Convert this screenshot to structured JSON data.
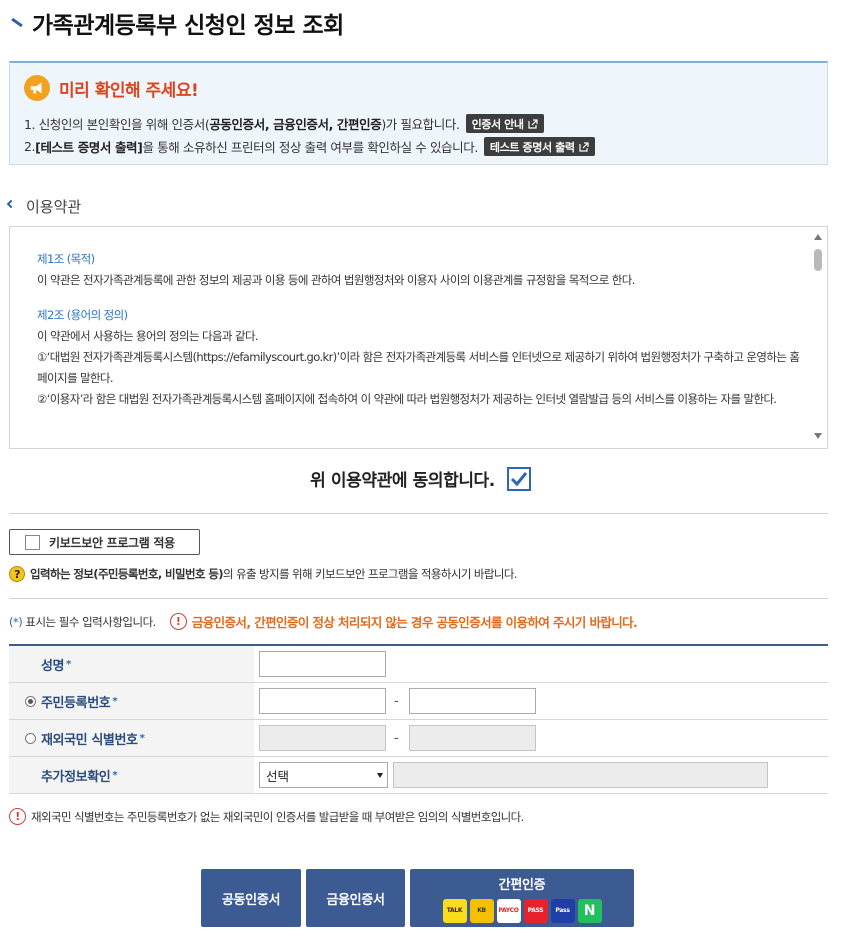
{
  "page": {
    "title": "가족관계등록부 신청인 정보 조회"
  },
  "notice": {
    "heading": "미리 확인해 주세요!",
    "line1_prefix": "1. 신청인의 본인확인을 위해 인증서(",
    "line1_bold": "공동인증서, 금융인증서, 간편인증",
    "line1_suffix": ")가 필요합니다.",
    "cert_guide_btn": "인증서 안내",
    "line2_prefix": "2. ",
    "line2_bold": "[테스트 증명서 출력]",
    "line2_suffix": "을 통해 소유하신 프린터의 정상 출력 여부를 확인하실 수 있습니다.",
    "test_print_btn": "테스트 증명서 출력"
  },
  "terms": {
    "label": "이용약관",
    "art1_title": "제1조 (목적)",
    "art1_text": "이 약관은 전자가족관계등록에 관한 정보의 제공과 이용 등에 관하여 법원행정처와 이용자 사이의 이용관계를 규정함을 목적으로 한다.",
    "art2_title": "제2조 (용어의 정의)",
    "art2_intro": "이 약관에서 사용하는 용어의 정의는 다음과 같다.",
    "art2_item1": "①‘대법원 전자가족관계등록시스템(https://efamilyscourt.go.kr)’이라 함은 전자가족관계등록 서비스를 인터넷으로 제공하기 위하여 법원행정처가 구축하고 운영하는 홈페이지를 말한다.",
    "art2_item2": "②‘이용자’라 함은 대법원 전자가족관계등록시스템 홈페이지에 접속하여 이 약관에 따라 법원행정처가 제공하는 인터넷 열람발급 등의 서비스를 이용하는 자를 말한다."
  },
  "agree": {
    "text": "위 이용약관에 동의합니다.",
    "checked": true
  },
  "keyboard": {
    "btn_label": "키보드보안 프로그램 적용",
    "note_bold": "입력하는 정보(주민등록번호, 비밀번호 등)",
    "note_rest": "의 유출 방지를 위해 키보드보안 프로그램을 적용하시기 바랍니다."
  },
  "required": {
    "note_star": "(*)",
    "note_text": " 표시는 필수 입력사항입니다.",
    "warning": "금융인증서, 간편인증이 정상 처리되지 않는 경우 공동인증서를 이용하여 주시기 바랍니다."
  },
  "form": {
    "name_label": "성명",
    "rrn_label": "주민등록번호",
    "foreign_label": "재외국민 식별번호",
    "extra_label": "추가정보확인",
    "star": "*",
    "dash": "-",
    "extra_select": "선택"
  },
  "footnote": "재외국민 식별번호는 주민등록번호가 없는 재외국민이 인증서를 발급받을 때 부여받은 임의의 식별번호입니다.",
  "buttons": {
    "joint": "공동인증서",
    "finance": "금융인증서",
    "simple": "간편인증",
    "logos": [
      "TALK",
      "KB",
      "PAYCO",
      "PASS",
      "Pass",
      "N"
    ]
  },
  "colors": {
    "accent": "#3b5b92",
    "warn": "#e46a1e",
    "notice_head": "#e0431f",
    "link_blue": "#2a75c5"
  }
}
